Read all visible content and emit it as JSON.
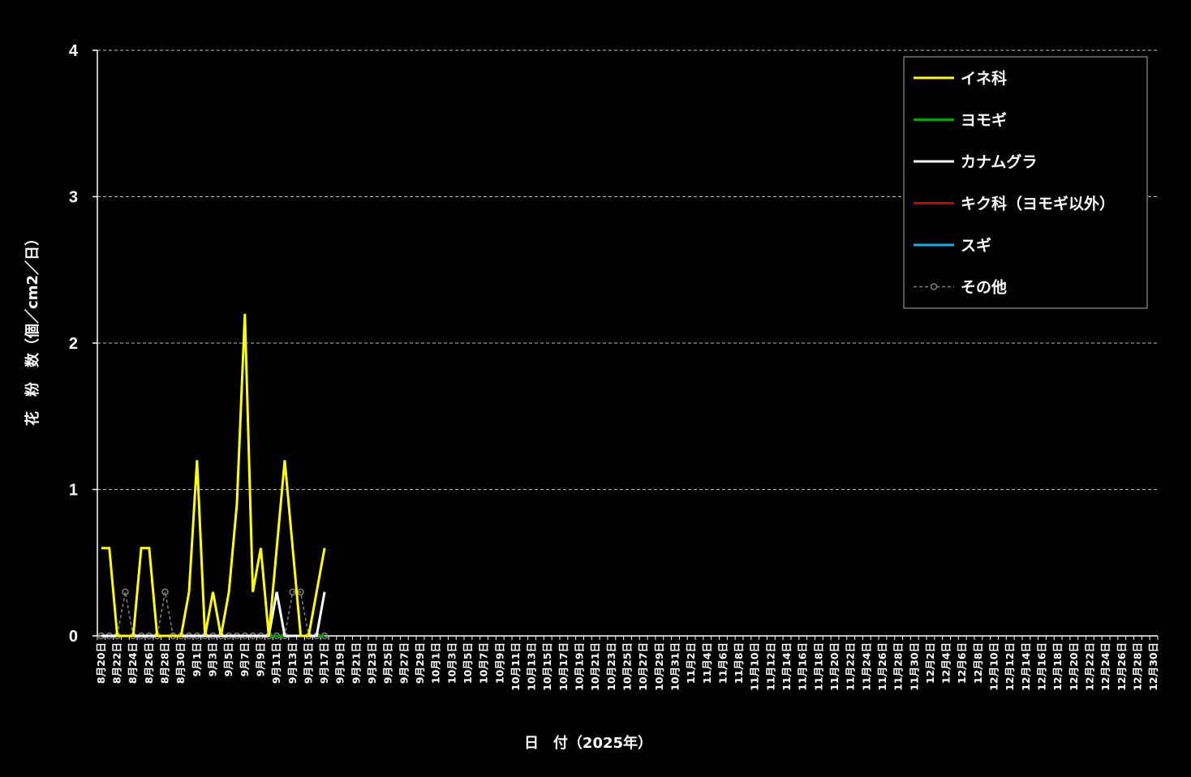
{
  "chart_data": {
    "type": "line",
    "xlabel": "日　付（2025年）",
    "ylabel": "花　粉　数（個／cm2／日）",
    "ylim": [
      0,
      4
    ],
    "yticks": [
      "0",
      "1",
      "2",
      "3",
      "4"
    ],
    "grid": true,
    "legend_position": "top-right",
    "categories": [
      "8月20日",
      "8月21日",
      "8月22日",
      "8月23日",
      "8月24日",
      "8月25日",
      "8月26日",
      "8月27日",
      "8月28日",
      "8月29日",
      "8月30日",
      "8月31日",
      "9月1日",
      "9月2日",
      "9月3日",
      "9月4日",
      "9月5日",
      "9月6日",
      "9月7日",
      "9月8日",
      "9月9日",
      "9月10日",
      "9月11日",
      "9月12日",
      "9月13日",
      "9月14日",
      "9月15日",
      "9月16日",
      "9月17日",
      "9月18日",
      "9月19日",
      "9月20日",
      "9月21日",
      "9月22日",
      "9月23日",
      "9月24日",
      "9月25日",
      "9月26日",
      "9月27日",
      "9月28日",
      "9月29日",
      "9月30日",
      "10月1日",
      "10月2日",
      "10月3日",
      "10月4日",
      "10月5日",
      "10月6日",
      "10月7日",
      "10月8日",
      "10月9日",
      "10月10日",
      "10月11日",
      "10月12日",
      "10月13日",
      "10月14日",
      "10月15日",
      "10月16日",
      "10月17日",
      "10月18日",
      "10月19日",
      "10月20日",
      "10月21日",
      "10月22日",
      "10月23日",
      "10月24日",
      "10月25日",
      "10月26日",
      "10月27日",
      "10月28日",
      "10月29日",
      "10月30日",
      "10月31日",
      "11月1日",
      "11月2日",
      "11月3日",
      "11月4日",
      "11月5日",
      "11月6日",
      "11月7日",
      "11月8日",
      "11月9日",
      "11月10日",
      "11月11日",
      "11月12日",
      "11月13日",
      "11月14日",
      "11月15日",
      "11月16日",
      "11月17日",
      "11月18日",
      "11月19日",
      "11月20日",
      "11月21日",
      "11月22日",
      "11月23日",
      "11月24日",
      "11月25日",
      "11月26日",
      "11月27日",
      "11月28日",
      "11月29日",
      "11月30日",
      "12月1日",
      "12月2日",
      "12月3日",
      "12月4日",
      "12月5日",
      "12月6日",
      "12月7日",
      "12月8日",
      "12月9日",
      "12月10日",
      "12月11日",
      "12月12日",
      "12月13日",
      "12月14日",
      "12月15日",
      "12月16日",
      "12月17日",
      "12月18日",
      "12月19日",
      "12月20日",
      "12月21日",
      "12月22日",
      "12月23日",
      "12月24日",
      "12月25日",
      "12月26日",
      "12月27日",
      "12月28日",
      "12月29日",
      "12月30日"
    ],
    "series": [
      {
        "name": "イネ科",
        "color": "#ffff00",
        "style": "solid",
        "values": [
          0.6,
          0.6,
          0,
          0,
          0,
          0.6,
          0.6,
          0,
          0,
          0,
          0,
          0.3,
          1.2,
          0,
          0.3,
          0,
          0.3,
          0.9,
          2.2,
          0.3,
          0.6,
          0,
          0.6,
          1.2,
          0.6,
          0,
          0,
          0.3,
          0.6
        ]
      },
      {
        "name": "ヨモギ",
        "color": "#00a000",
        "style": "solid",
        "values": [
          0,
          0,
          0,
          0,
          0,
          0,
          0,
          0,
          0,
          0,
          0,
          0,
          0,
          0,
          0,
          0,
          0,
          0,
          0,
          0,
          0,
          0,
          0,
          0,
          0,
          0,
          0,
          0,
          0
        ]
      },
      {
        "name": "カナムグラ",
        "color": "#ffffff",
        "style": "solid",
        "values": [
          0,
          0,
          0,
          0,
          0,
          0,
          0,
          0,
          0,
          0,
          0,
          0,
          0,
          0,
          0,
          0,
          0,
          0,
          0,
          0,
          0,
          0,
          0.3,
          0,
          0,
          0,
          0,
          0,
          0.3
        ]
      },
      {
        "name": "キク科（ヨモギ以外）",
        "color": "#c00000",
        "style": "solid",
        "values": [
          0,
          0,
          0,
          0,
          0,
          0,
          0,
          0,
          0,
          0,
          0,
          0,
          0,
          0,
          0,
          0,
          0,
          0,
          0,
          0,
          0,
          0,
          0,
          0,
          0,
          0,
          0,
          0,
          0
        ]
      },
      {
        "name": "スギ",
        "color": "#00b0f0",
        "style": "solid",
        "values": [
          0,
          0,
          0,
          0,
          0,
          0,
          0,
          0,
          0,
          0,
          0,
          0,
          0,
          0,
          0,
          0,
          0,
          0,
          0,
          0,
          0,
          0,
          0,
          0,
          0,
          0,
          0,
          0,
          0
        ]
      },
      {
        "name": "その他",
        "color": "#808080",
        "style": "dashed-marker",
        "values": [
          0,
          0,
          0,
          0.3,
          0,
          0,
          0,
          0,
          0.3,
          0,
          0,
          0,
          0,
          0,
          0,
          0,
          0,
          0,
          0,
          0,
          0,
          0,
          0,
          0,
          0.3,
          0.3,
          0,
          0,
          0
        ]
      }
    ]
  }
}
